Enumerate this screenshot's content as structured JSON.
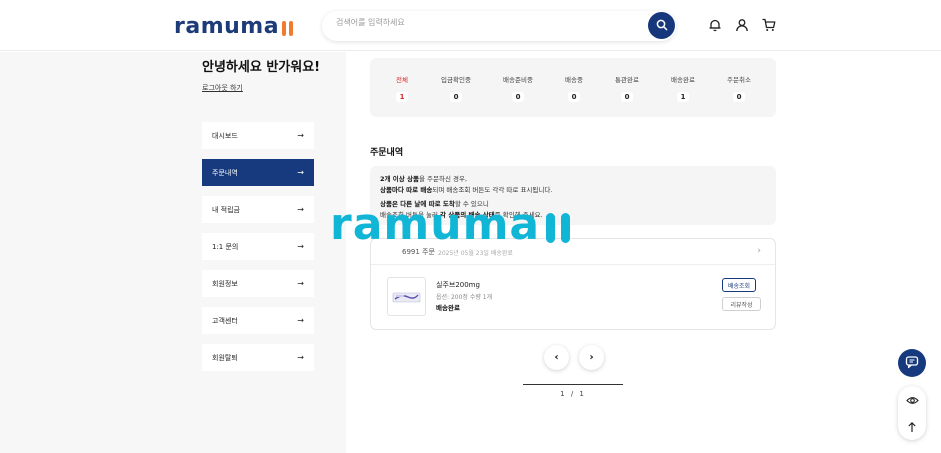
{
  "header": {
    "logo_text": "ramuma",
    "logo_bars": "ll",
    "search_placeholder": "검색어를 입력하세요",
    "icons": [
      "search-icon",
      "bell-icon",
      "user-icon",
      "cart-icon"
    ]
  },
  "sidebar": {
    "greeting": "안녕하세요 반가워요!",
    "logout": "로그아웃 하기",
    "items": [
      {
        "label": "대시보드",
        "active": false
      },
      {
        "label": "주문내역",
        "active": true
      },
      {
        "label": "내 적립금",
        "active": false
      },
      {
        "label": "1:1 문의",
        "active": false
      },
      {
        "label": "회원정보",
        "active": false
      },
      {
        "label": "고객센터",
        "active": false
      },
      {
        "label": "회원탈퇴",
        "active": false
      }
    ],
    "arrow": "→"
  },
  "status": [
    {
      "label": "전체",
      "count": "1"
    },
    {
      "label": "입금확인중",
      "count": "0"
    },
    {
      "label": "배송준비중",
      "count": "0"
    },
    {
      "label": "배송중",
      "count": "0"
    },
    {
      "label": "통관완료",
      "count": "0"
    },
    {
      "label": "배송완료",
      "count": "1"
    },
    {
      "label": "주문취소",
      "count": "0"
    }
  ],
  "orders_section": {
    "title": "주문내역",
    "notice": {
      "line1_bold": "2개 이상 상품",
      "line1_rest": "을 주문하신 경우,",
      "line2_bold": "상품마다 따로 배송",
      "line2_rest": "되며 배송조회 버튼도 각각 따로 표시됩니다.",
      "line3_bold": "상품은 다른 날에 따로 도착",
      "line3_rest": "할 수 있으니",
      "line4_a": "배송조회 버튼을 눌러 ",
      "line4_bold": "각 상품의 배송 상태",
      "line4_rest": "를 확인해 주세요."
    },
    "order": {
      "number": "6991 주문",
      "date": "2025년 05월 23일 배송완료",
      "product_name": "실주브200mg",
      "product_option": "옵션: 200정 수량 1개",
      "product_status": "배송완료",
      "track_button": "배송조회",
      "review_button": "리뷰작성"
    }
  },
  "pagination": {
    "prev": "‹",
    "next": "›",
    "current": "1",
    "separator": "/",
    "total": "1"
  },
  "watermark": {
    "text": "ramuma",
    "bars": "ll"
  },
  "colors": {
    "brand_navy": "#173a7e",
    "brand_orange": "#f07c2d",
    "watermark_cyan": "#11b5d6",
    "status_red": "#d9292a"
  }
}
